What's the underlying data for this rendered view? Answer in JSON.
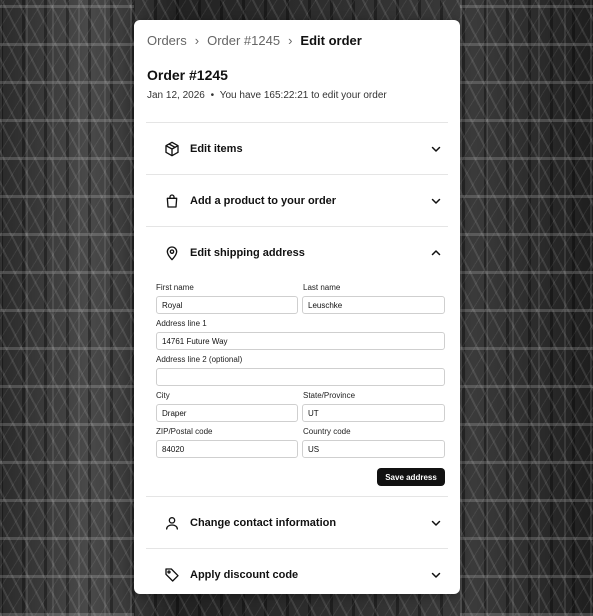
{
  "breadcrumb": {
    "orders": "Orders",
    "order": "Order #1245",
    "current": "Edit order"
  },
  "order": {
    "title": "Order #1245",
    "date": "Jan 12, 2026",
    "separator": "•",
    "countdown_text": "You have 165:22:21 to edit your order"
  },
  "sections": {
    "edit_items": {
      "label": "Edit items",
      "icon": "box-icon",
      "expanded": false
    },
    "add_product": {
      "label": "Add a product to your order",
      "icon": "shopping-bag-icon",
      "expanded": false
    },
    "shipping": {
      "label": "Edit shipping address",
      "icon": "map-pin-icon",
      "expanded": true
    },
    "contact": {
      "label": "Change contact information",
      "icon": "user-icon",
      "expanded": false
    },
    "discount": {
      "label": "Apply discount code",
      "icon": "tag-icon",
      "expanded": false
    }
  },
  "shipping_form": {
    "first_name": {
      "label": "First name",
      "value": "Royal"
    },
    "last_name": {
      "label": "Last name",
      "value": "Leuschke"
    },
    "address1": {
      "label": "Address line 1",
      "value": "14761 Future Way"
    },
    "address2": {
      "label": "Address line 2 (optional)",
      "value": ""
    },
    "city": {
      "label": "City",
      "value": "Draper"
    },
    "state": {
      "label": "State/Province",
      "value": "UT"
    },
    "zip": {
      "label": "ZIP/Postal code",
      "value": "84020"
    },
    "country": {
      "label": "Country code",
      "value": "US"
    },
    "save_label": "Save address"
  },
  "colors": {
    "primary": "#111111",
    "border": "#e5e5e5",
    "muted": "#666666"
  }
}
